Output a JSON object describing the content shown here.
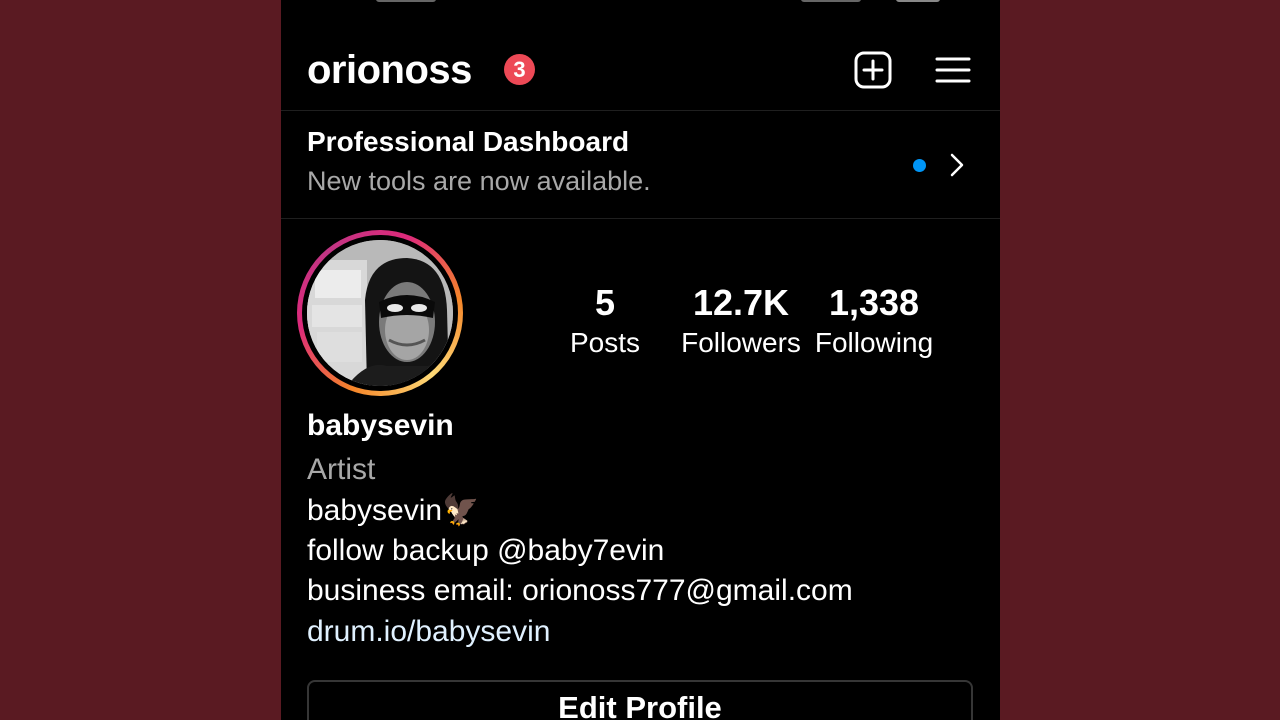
{
  "header": {
    "username": "orionoss",
    "notification_count": "3"
  },
  "dashboard": {
    "title": "Professional Dashboard",
    "subtitle": "New tools are now available."
  },
  "stats": {
    "posts": {
      "value": "5",
      "label": "Posts"
    },
    "followers": {
      "value": "12.7K",
      "label": "Followers"
    },
    "following": {
      "value": "1,338",
      "label": "Following"
    }
  },
  "profile": {
    "name": "babysevin",
    "category": "Artist",
    "bio_line_1": "babysevin🦅",
    "bio_line_2": "follow backup @baby7evin",
    "bio_line_3": "business email: orionoss777@gmail.com",
    "link": "drum.io/babysevin"
  },
  "actions": {
    "edit_profile": "Edit Profile"
  },
  "colors": {
    "background_outer": "#5a1a22",
    "screen": "#000000",
    "badge": "#ed4956",
    "dot": "#0095f6",
    "secondary_text": "#a8a8a8"
  },
  "icons": {
    "create": "plus-square-icon",
    "menu": "hamburger-menu-icon",
    "chevron": "chevron-right-icon"
  }
}
